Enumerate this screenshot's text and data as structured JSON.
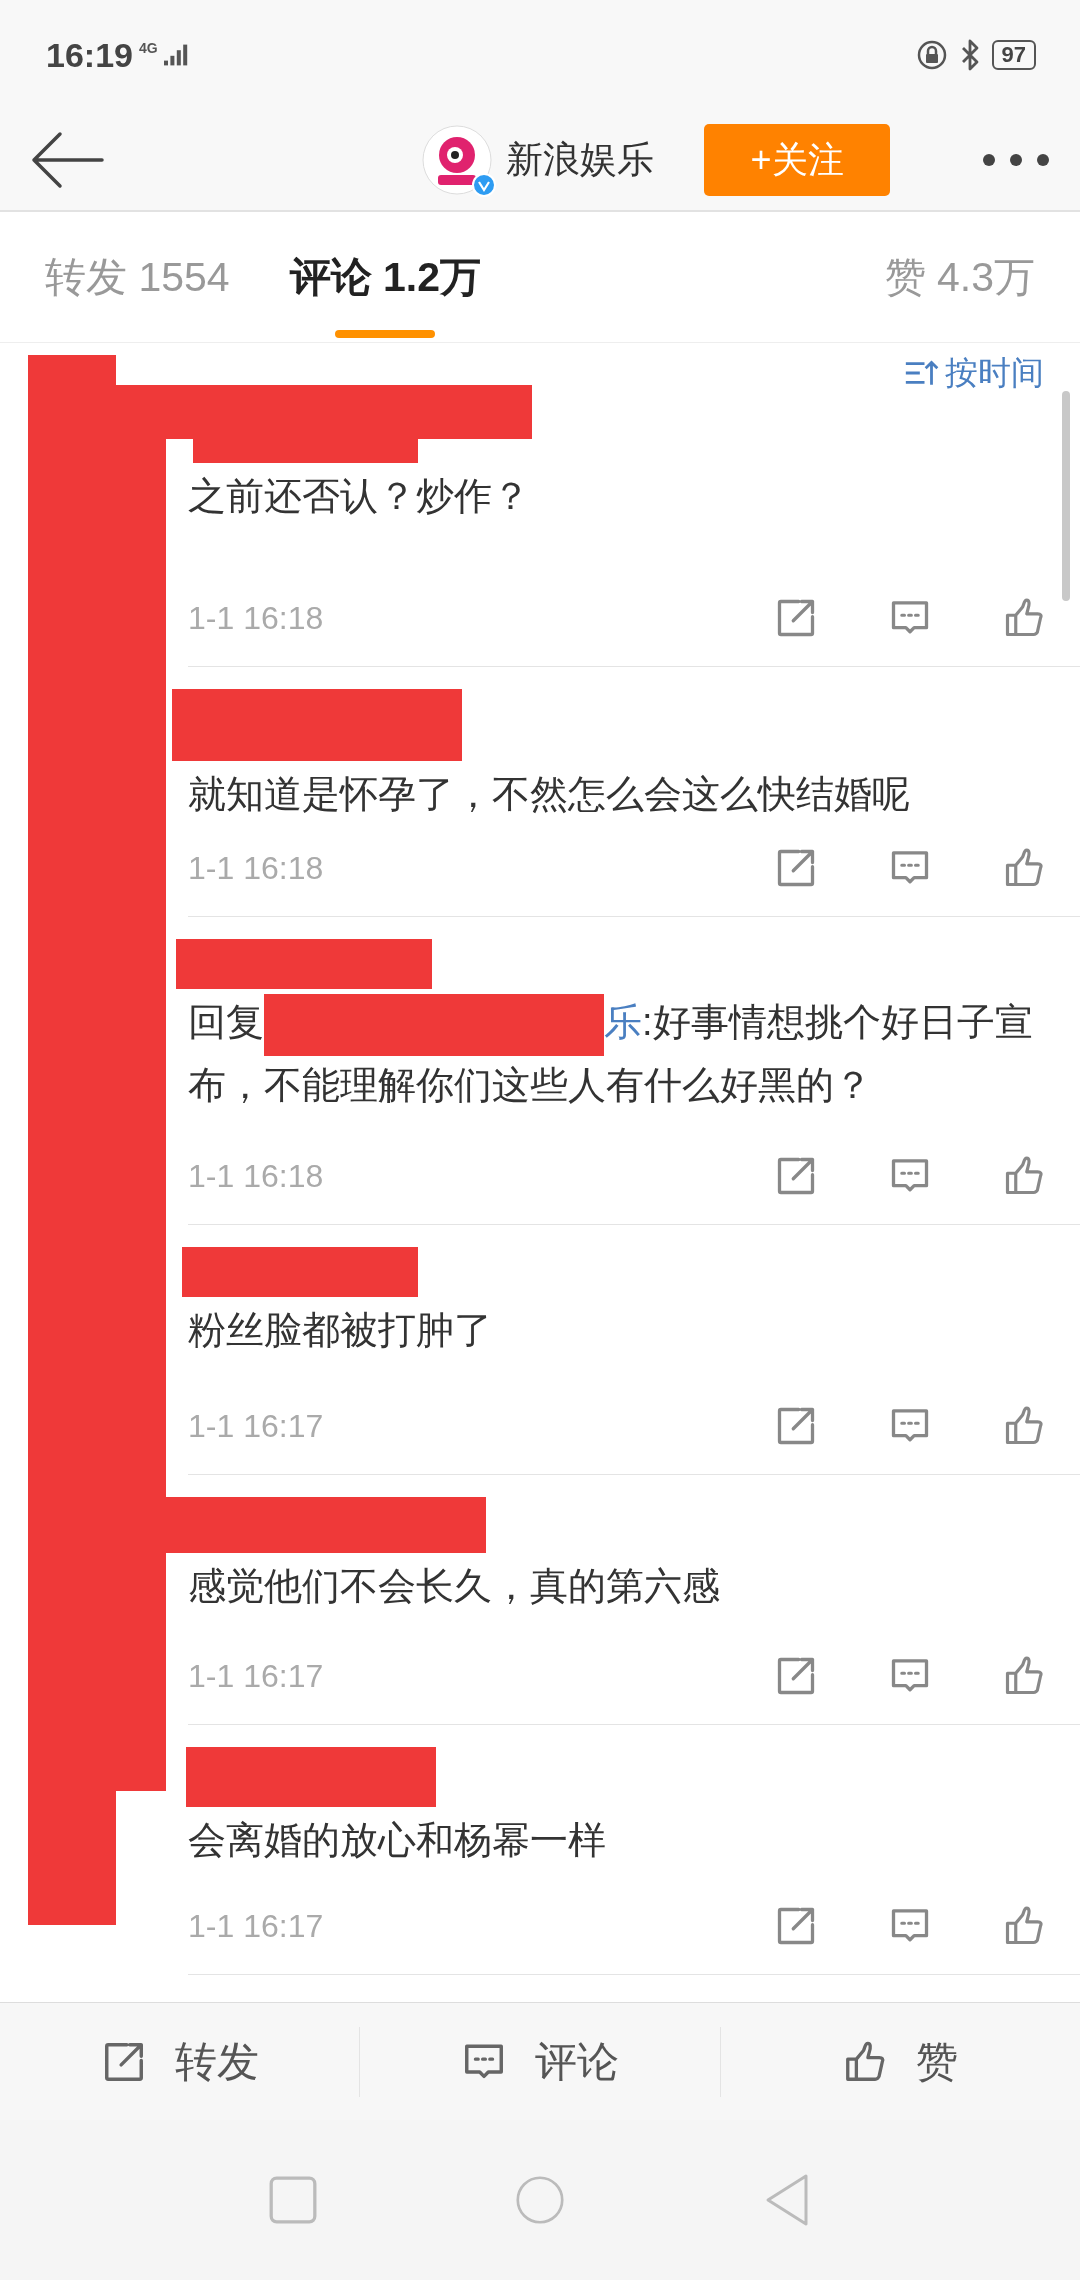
{
  "status_bar": {
    "time": "16:19",
    "network": "4G",
    "battery": "97"
  },
  "header": {
    "account_name": "新浪娱乐",
    "verified": true,
    "follow_button": "+关注"
  },
  "tabs": [
    {
      "label": "转发 1554",
      "selected": false
    },
    {
      "label": "评论 1.2万",
      "selected": true
    },
    {
      "label": "赞 4.3万",
      "selected": false
    }
  ],
  "sort": {
    "label": "按时间"
  },
  "comments": [
    {
      "author": {
        "redacted": true
      },
      "text": "之前还否认？炒作？",
      "time": "1-1 16:18"
    },
    {
      "author": {
        "redacted": true
      },
      "text": "就知道是怀孕了，不然怎么会这么快结婚呢",
      "time": "1-1 16:18"
    },
    {
      "author": {
        "redacted": true
      },
      "reply": {
        "prefix": "回复",
        "target_redacted": true,
        "target_visible": "乐"
      },
      "text": ":好事情想挑个好日子宣布，不能理解你们这些人有什么好黑的？",
      "time": "1-1 16:18"
    },
    {
      "author": {
        "redacted": true
      },
      "text": "粉丝脸都被打肿了",
      "time": "1-1 16:17"
    },
    {
      "author": {
        "redacted": true
      },
      "text": "感觉他们不会长久，真的第六感",
      "time": "1-1 16:17"
    },
    {
      "author": {
        "redacted": true
      },
      "text": "会离婚的放心和杨幂一样",
      "time": "1-1 16:17"
    }
  ],
  "action_bar": [
    {
      "kind": "repost",
      "label": "转发"
    },
    {
      "kind": "comment",
      "label": "评论"
    },
    {
      "kind": "like",
      "label": "赞"
    }
  ]
}
